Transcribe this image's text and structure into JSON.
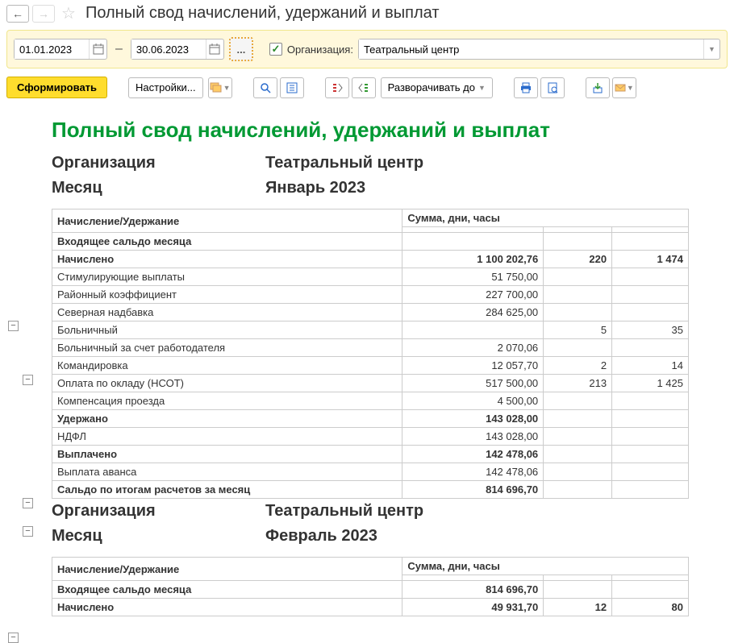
{
  "title": "Полный свод начислений, удержаний и выплат",
  "period": {
    "from": "01.01.2023",
    "to": "30.06.2023",
    "ellipsis": "..."
  },
  "org": {
    "label": "Организация:",
    "value": "Театральный центр"
  },
  "toolbar": {
    "submit": "Сформировать",
    "settings": "Настройки...",
    "expand": "Разворачивать до"
  },
  "report": {
    "title": "Полный свод начислений, удержаний и выплат",
    "labels": {
      "org": "Организация",
      "month": "Месяц",
      "col1": "Начисление/Удержание",
      "col2": "Сумма, дни, часы"
    },
    "sections": [
      {
        "org": "Театральный центр",
        "month": "Январь 2023",
        "rows": [
          {
            "name": "Входящее сальдо месяца",
            "sum": "",
            "days": "",
            "hours": "",
            "bold": true
          },
          {
            "name": "Начислено",
            "sum": "1 100 202,76",
            "days": "220",
            "hours": "1 474",
            "bold": true
          },
          {
            "name": "Стимулирующие выплаты",
            "sum": "51 750,00",
            "days": "",
            "hours": ""
          },
          {
            "name": "Районный коэффициент",
            "sum": "227 700,00",
            "days": "",
            "hours": ""
          },
          {
            "name": "Северная надбавка",
            "sum": "284 625,00",
            "days": "",
            "hours": ""
          },
          {
            "name": "Больничный",
            "sum": "",
            "days": "5",
            "hours": "35"
          },
          {
            "name": "Больничный за счет работодателя",
            "sum": "2 070,06",
            "days": "",
            "hours": ""
          },
          {
            "name": "Командировка",
            "sum": "12 057,70",
            "days": "2",
            "hours": "14"
          },
          {
            "name": "Оплата по окладу (НСОТ)",
            "sum": "517 500,00",
            "days": "213",
            "hours": "1 425"
          },
          {
            "name": "Компенсация проезда",
            "sum": "4 500,00",
            "days": "",
            "hours": ""
          },
          {
            "name": "Удержано",
            "sum": "143 028,00",
            "days": "",
            "hours": "",
            "bold": true
          },
          {
            "name": "НДФЛ",
            "sum": "143 028,00",
            "days": "",
            "hours": ""
          },
          {
            "name": "Выплачено",
            "sum": "142 478,06",
            "days": "",
            "hours": "",
            "bold": true
          },
          {
            "name": "Выплата аванса",
            "sum": "142 478,06",
            "days": "",
            "hours": ""
          },
          {
            "name": "Сальдо по итогам расчетов за месяц",
            "sum": "814 696,70",
            "days": "",
            "hours": "",
            "bold": true
          }
        ]
      },
      {
        "org": "Театральный центр",
        "month": "Февраль 2023",
        "rows": [
          {
            "name": "Входящее сальдо месяца",
            "sum": "814 696,70",
            "days": "",
            "hours": "",
            "bold": true
          },
          {
            "name": "Начислено",
            "sum": "49 931,70",
            "days": "12",
            "hours": "80",
            "bold": true
          }
        ]
      }
    ]
  }
}
